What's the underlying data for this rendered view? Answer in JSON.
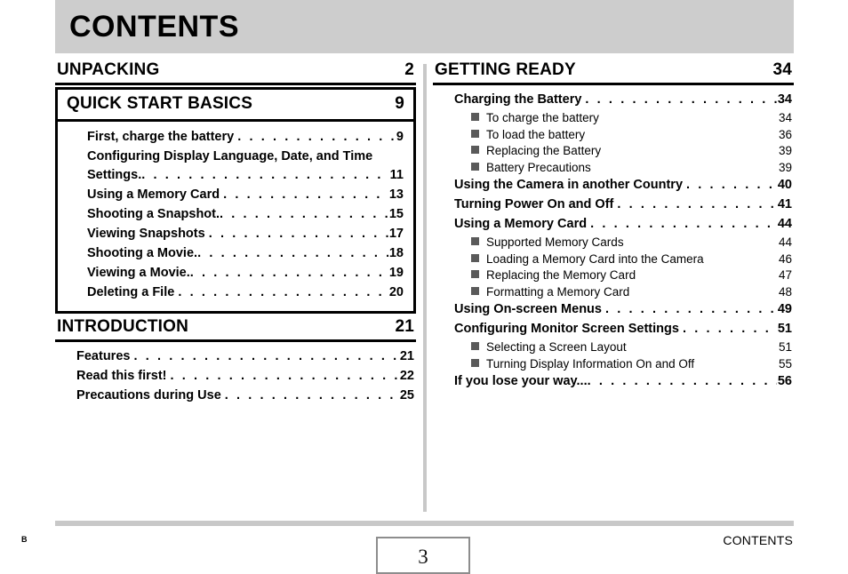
{
  "header": {
    "title": "CONTENTS",
    "band_color": "#cdcdcd"
  },
  "footer": {
    "left_mark": "B",
    "page_number": "3",
    "right_label": "CONTENTS",
    "rule_color": "#c8c8c8"
  },
  "leader_dots": ". . . . . . . . . . . . . . . . . . . . . . . . . . . . . . . . . . . . . . . . . . . . . . . . . . . . . . . . .",
  "columns": {
    "left": [
      {
        "id": "unpacking",
        "title": "UNPACKING",
        "page": "2",
        "boxed": false,
        "entries": []
      },
      {
        "id": "quick-start-basics",
        "title": "QUICK START BASICS",
        "page": "9",
        "boxed": true,
        "entries": [
          {
            "text": "First, charge the battery",
            "page": "9"
          },
          {
            "text": "Configuring Display Language, Date, and Time",
            "text2": "Settings.",
            "page": "11",
            "wrapped": true
          },
          {
            "text": "Using a Memory Card",
            "page": "13"
          },
          {
            "text": "Shooting a Snapshot.",
            "page": "15"
          },
          {
            "text": "Viewing Snapshots",
            "page": "17"
          },
          {
            "text": "Shooting a Movie.",
            "page": "18"
          },
          {
            "text": "Viewing a Movie.",
            "page": "19"
          },
          {
            "text": "Deleting a File",
            "page": "20"
          }
        ]
      },
      {
        "id": "introduction",
        "title": "INTRODUCTION",
        "page": "21",
        "boxed": false,
        "entries": [
          {
            "text": "Features",
            "page": "21"
          },
          {
            "text": "Read this first!",
            "page": "22"
          },
          {
            "text": "Precautions during Use",
            "page": "25"
          }
        ]
      }
    ],
    "right": [
      {
        "id": "getting-ready",
        "title": "GETTING READY",
        "page": "34",
        "boxed": false,
        "entries": [
          {
            "text": "Charging the Battery",
            "page": "34",
            "subs": [
              {
                "text": "To charge the battery",
                "page": "34"
              },
              {
                "text": "To load the battery",
                "page": "36"
              },
              {
                "text": "Replacing the Battery",
                "page": "39"
              },
              {
                "text": "Battery Precautions",
                "page": "39"
              }
            ]
          },
          {
            "text": "Using the Camera in another Country",
            "page": "40",
            "subs": []
          },
          {
            "text": "Turning Power On and Off",
            "page": "41",
            "subs": []
          },
          {
            "text": "Using a Memory Card",
            "page": "44",
            "subs": [
              {
                "text": "Supported Memory Cards",
                "page": "44"
              },
              {
                "text": "Loading a Memory Card into the Camera",
                "page": "46"
              },
              {
                "text": "Replacing the Memory Card",
                "page": "47"
              },
              {
                "text": "Formatting a Memory Card",
                "page": "48"
              }
            ]
          },
          {
            "text": "Using On-screen Menus",
            "page": "49",
            "subs": []
          },
          {
            "text": "Configuring Monitor Screen Settings",
            "page": "51",
            "subs": [
              {
                "text": "Selecting a Screen Layout",
                "page": "51"
              },
              {
                "text": "Turning Display Information On and Off",
                "page": "55"
              }
            ]
          },
          {
            "text": "If you lose your way...",
            "page": "56",
            "subs": []
          }
        ]
      }
    ]
  }
}
